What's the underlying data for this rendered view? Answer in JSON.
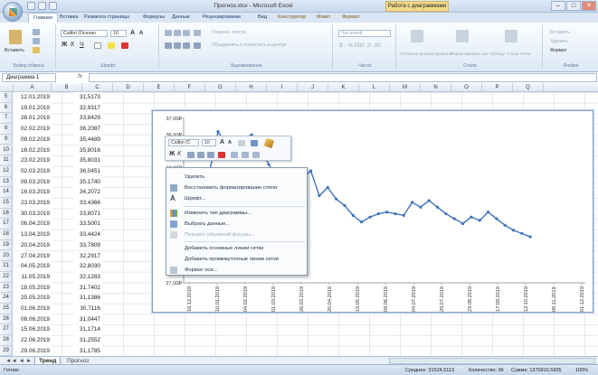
{
  "window": {
    "title": "Прогноз.xlsx - Microsoft Excel",
    "context_title": "Работа с диаграммами",
    "min": "–",
    "max": "□",
    "close": "✕"
  },
  "tabs": [
    "Главная",
    "Вставка",
    "Разметка страницы",
    "Формулы",
    "Данные",
    "Рецензирование",
    "Вид",
    "Конструктор",
    "Макет",
    "Формат"
  ],
  "ribbon": {
    "clipboard": {
      "paste": "Вставить",
      "label": "Буфер обмена"
    },
    "font": {
      "name": "Calibri (Основн",
      "size": "10",
      "bold": "Ж",
      "italic": "К",
      "underline": "Ч",
      "label": "Шрифт"
    },
    "align": {
      "wrap": "Перенос текста",
      "merge": "Объединить и поместить в центре",
      "label": "Выравнивание"
    },
    "number": {
      "format": "Числовой",
      "label": "Число"
    },
    "styles": {
      "cond": "Условное форматирование",
      "table": "Форматировать как таблицу",
      "cell": "Стили ячеек",
      "label": "Стили"
    },
    "cells": {
      "insert": "Вставить",
      "delete": "Удалить",
      "format": "Формат",
      "label": "Ячейки"
    }
  },
  "formula": {
    "namebox": "Диаграмма 1",
    "fx": "fx",
    "value": ""
  },
  "columns": [
    "A",
    "B",
    "C",
    "D",
    "E",
    "F",
    "G",
    "H",
    "I",
    "J",
    "K",
    "L",
    "M",
    "N",
    "O",
    "P",
    "Q"
  ],
  "rows": [
    {
      "n": "5",
      "date": "12.01.2019",
      "val": "31,5173"
    },
    {
      "n": "6",
      "date": "19.01.2019",
      "val": "32,9317"
    },
    {
      "n": "7",
      "date": "26.01.2019",
      "val": "33,8429"
    },
    {
      "n": "8",
      "date": "02.02.2019",
      "val": "36,2087"
    },
    {
      "n": "9",
      "date": "09.02.2019",
      "val": "35,4489"
    },
    {
      "n": "10",
      "date": "16.02.2019",
      "val": "35,8016"
    },
    {
      "n": "11",
      "date": "23.02.2019",
      "val": "35,8031"
    },
    {
      "n": "12",
      "date": "02.03.2019",
      "val": "36,0451"
    },
    {
      "n": "13",
      "date": "09.03.2019",
      "val": "35,1740"
    },
    {
      "n": "14",
      "date": "16.03.2019",
      "val": "34,2072"
    },
    {
      "n": "15",
      "date": "23.03.2019",
      "val": "33,4366"
    },
    {
      "n": "16",
      "date": "30.03.2019",
      "val": "33,8071"
    },
    {
      "n": "17",
      "date": "06.04.2019",
      "val": "33,5001"
    },
    {
      "n": "18",
      "date": "13.04.2019",
      "val": "33,4424"
    },
    {
      "n": "19",
      "date": "20.04.2019",
      "val": "33,7809"
    },
    {
      "n": "20",
      "date": "27.04.2019",
      "val": "32,2917"
    },
    {
      "n": "21",
      "date": "04.05.2019",
      "val": "32,8030"
    },
    {
      "n": "22",
      "date": "11.05.2019",
      "val": "32,1283"
    },
    {
      "n": "23",
      "date": "18.05.2019",
      "val": "31,7402"
    },
    {
      "n": "24",
      "date": "25.05.2019",
      "val": "31,1386"
    },
    {
      "n": "25",
      "date": "01.06.2019",
      "val": "30,7116"
    },
    {
      "n": "26",
      "date": "08.06.2019",
      "val": "31,0447"
    },
    {
      "n": "27",
      "date": "15.06.2019",
      "val": "31,1714"
    },
    {
      "n": "28",
      "date": "22.06.2019",
      "val": "31,2552"
    },
    {
      "n": "29",
      "date": "29.06.2019",
      "val": "31,1785"
    }
  ],
  "chart_data": {
    "type": "line",
    "y_ticks": [
      "37,00₽",
      "36,00₽",
      "35,00₽",
      "34,00₽",
      "33,00₽",
      "32,00₽",
      "31,00₽",
      "30,00₽",
      "29,00₽",
      "28,00₽",
      "27,00₽"
    ],
    "ylim": [
      27,
      37
    ],
    "x_ticks": [
      "16.12.2018",
      "10.01.2019",
      "04.02.2019",
      "01.03.2019",
      "26.03.2019",
      "20.04.2019",
      "15.05.2019",
      "09.06.2019",
      "04.07.2019",
      "29.07.2019",
      "23.08.2019",
      "17.09.2019",
      "12.10.2019",
      "06.11.2019",
      "01.12.2019"
    ],
    "series": [
      {
        "values": [
          31.5,
          32.9,
          33.8,
          36.2,
          35.4,
          35.8,
          35.8,
          36.0,
          35.2,
          34.2,
          33.4,
          33.8,
          33.5,
          33.4,
          33.8,
          32.3,
          32.8,
          32.1,
          31.7,
          31.1,
          30.7,
          31.0,
          31.2,
          31.3,
          31.2,
          31.1,
          31.9,
          31.6,
          32.0,
          31.6,
          31.2,
          30.9,
          30.6,
          31.0,
          30.8,
          31.3,
          30.9,
          30.5,
          30.2,
          30.0,
          29.8
        ]
      }
    ],
    "color": "#3f73b8"
  },
  "minibar": {
    "font": "Calibri (С",
    "size": "10",
    "grow": "A",
    "shrink": "A",
    "bold": "Ж",
    "italic": "К"
  },
  "context_menu": [
    {
      "label": "Удалить",
      "enabled": true
    },
    {
      "label": "Восстановить форматирование стиля",
      "enabled": true
    },
    {
      "label": "Шрифт...",
      "enabled": true
    },
    {
      "label": "Изменить тип диаграммы...",
      "enabled": true
    },
    {
      "label": "Выбрать данные...",
      "enabled": true
    },
    {
      "label": "Поворот объемной фигуры...",
      "enabled": false
    },
    {
      "label": "Добавить основные линии сетки",
      "enabled": true
    },
    {
      "label": "Добавить промежуточные линии сетки",
      "enabled": true
    },
    {
      "label": "Формат оси...",
      "enabled": true
    }
  ],
  "sheets": {
    "active": "Тренд",
    "other": "Прогноз",
    "nav": "◄◄ ◄ ► ►►"
  },
  "status": {
    "ready": "Готово",
    "avg": "Среднее: 31524,5113",
    "count": "Количество: 96",
    "sum": "Сумма: 1370916,5935",
    "zoom": "100%"
  }
}
